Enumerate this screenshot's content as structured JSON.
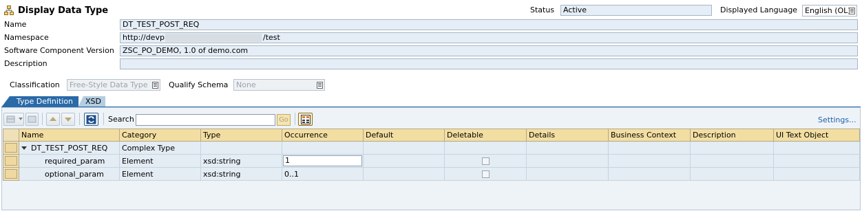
{
  "header": {
    "title": "Display Data Type",
    "title_icon": "data-type-hierarchy-icon",
    "status_label": "Status",
    "status_value": "Active",
    "language_label": "Displayed Language",
    "language_value": "English (OL)"
  },
  "fields": {
    "name_label": "Name",
    "name_value": "DT_TEST_POST_REQ",
    "namespace_label": "Namespace",
    "namespace_prefix": "http://devp",
    "namespace_suffix": "/test",
    "swcv_label": "Software Component Version",
    "swcv_value": "ZSC_PO_DEMO, 1.0 of demo.com",
    "description_label": "Description",
    "description_value": ""
  },
  "classification": {
    "label": "Classification",
    "value": "Free-Style Data Type",
    "qualify_label": "Qualify Schema",
    "qualify_value": "None"
  },
  "tabs": [
    {
      "label": "Type Definition",
      "active": true
    },
    {
      "label": "XSD",
      "active": false
    }
  ],
  "toolbar": {
    "search_label": "Search",
    "search_value": "",
    "go_label": "Go",
    "settings_label": "Settings..."
  },
  "table": {
    "columns": [
      "Name",
      "Category",
      "Type",
      "Occurrence",
      "Default",
      "Deletable",
      "Details",
      "Business Context",
      "Description",
      "UI Text Object"
    ],
    "rows": [
      {
        "name": "DT_TEST_POST_REQ",
        "category": "Complex Type",
        "type": "",
        "occurrence": "",
        "default": "",
        "deletable": null,
        "expanded": true
      },
      {
        "name": "required_param",
        "category": "Element",
        "type": "xsd:string",
        "occurrence": "1",
        "default": "",
        "deletable": false
      },
      {
        "name": "optional_param",
        "category": "Element",
        "type": "xsd:string",
        "occurrence": "0..1",
        "default": "",
        "deletable": false
      }
    ]
  },
  "colors": {
    "tab_active": "#2a6aa8",
    "header_row": "#f3dea2",
    "field_bg": "#e5eef6",
    "link": "#1f5fa8"
  }
}
